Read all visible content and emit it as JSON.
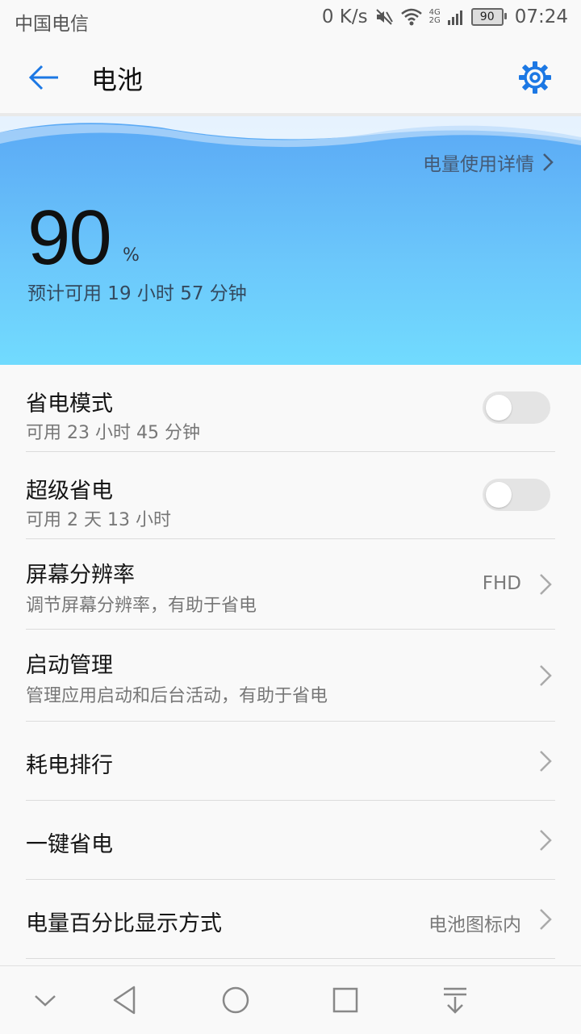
{
  "status_bar": {
    "carrier": "中国电信",
    "speed": "0 K/s",
    "net_top": "4G",
    "net_bottom": "2G",
    "battery": "90",
    "time": "07:24"
  },
  "header": {
    "title": "电池",
    "back_icon": "arrow-left-icon",
    "settings_icon": "gear-icon"
  },
  "hero": {
    "details_link": "电量使用详情",
    "percent": "90",
    "percent_sign": "%",
    "estimate": "预计可用 19 小时 57 分钟"
  },
  "rows": [
    {
      "title": "省电模式",
      "subtitle": "可用 23 小时 45 分钟",
      "toggle": false
    },
    {
      "title": "超级省电",
      "subtitle": "可用 2 天 13 小时",
      "toggle": false
    },
    {
      "title": "屏幕分辨率",
      "subtitle": "调节屏幕分辨率，有助于省电",
      "value": "FHD"
    },
    {
      "title": "启动管理",
      "subtitle": "管理应用启动和后台活动，有助于省电"
    },
    {
      "title": "耗电排行"
    },
    {
      "title": "一键省电"
    },
    {
      "title": "电量百分比显示方式",
      "value": "电池图标内"
    }
  ],
  "colors": {
    "accent": "#1c78e4",
    "hero_top": "#5aa8f5",
    "hero_bottom": "#71dbfe"
  }
}
